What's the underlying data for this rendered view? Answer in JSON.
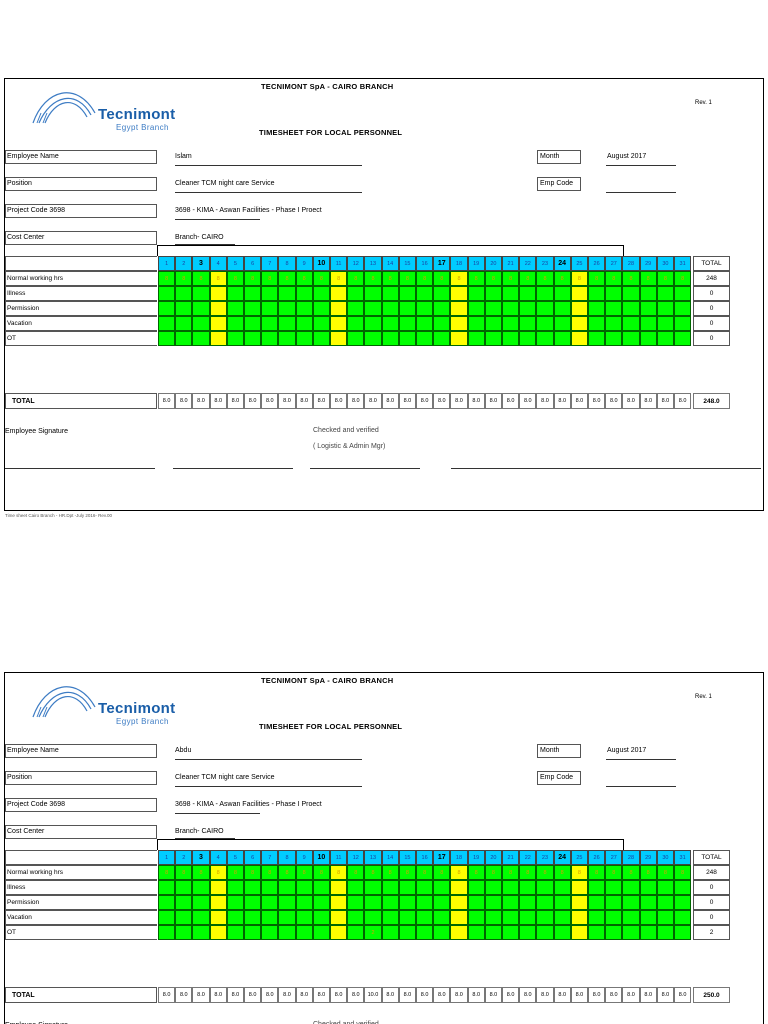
{
  "sheets": [
    {
      "company": "TECNIMONT SpA - CAIRO BRANCH",
      "logo": {
        "name": "Tecnimont",
        "sub": "Egypt Branch"
      },
      "rev": "Rev. 1",
      "title": "TIMESHEET FOR LOCAL PERSONNEL",
      "fields": {
        "employee_name_label": "Employee Name",
        "employee_name": "Islam",
        "position_label": "Position",
        "position": "Cleaner TCM night care Service",
        "project_code_label": "Project Code 3698",
        "project": "3698 - KIMA - Aswan Facilities - Phase I Proect",
        "cost_center_label": "Cost Center",
        "cost_center": "Branch- CAIRO",
        "month_label": "Month",
        "month": "August 2017",
        "emp_code_label": "Emp Code",
        "emp_code": ""
      },
      "total_header": "TOTAL",
      "rows": [
        {
          "label": "Normal working hrs",
          "cells": "8",
          "total": "248"
        },
        {
          "label": "Illness",
          "cells": "",
          "total": "0"
        },
        {
          "label": "Permission",
          "cells": "",
          "total": "0"
        },
        {
          "label": "Vacation",
          "cells": "",
          "total": "0"
        },
        {
          "label": "OT",
          "cells": "",
          "total": "0"
        }
      ],
      "ot_values": {},
      "total_label": "TOTAL",
      "daily_totals": [
        "8.0",
        "8.0",
        "8.0",
        "8.0",
        "8.0",
        "8.0",
        "8.0",
        "8.0",
        "8.0",
        "8.0",
        "8.0",
        "8.0",
        "8.0",
        "8.0",
        "8.0",
        "8.0",
        "8.0",
        "8.0",
        "8.0",
        "8.0",
        "8.0",
        "8.0",
        "8.0",
        "8.0",
        "8.0",
        "8.0",
        "8.0",
        "8.0",
        "8.0",
        "8.0",
        "8.0"
      ],
      "grand_total": "248.0",
      "signature_label": "Employee Signature",
      "checked": "Checked and verified",
      "checked_by": "( Logistic & Admin Mgr)",
      "footer_note": "Time sheet Cairo Branch - HR.Dpt -July 2016- Rev.00"
    },
    {
      "company": "TECNIMONT SpA - CAIRO BRANCH",
      "logo": {
        "name": "Tecnimont",
        "sub": "Egypt Branch"
      },
      "rev": "Rev. 1",
      "title": "TIMESHEET FOR LOCAL PERSONNEL",
      "fields": {
        "employee_name_label": "Employee Name",
        "employee_name": "Abdu",
        "position_label": "Position",
        "position": "Cleaner TCM night care Service",
        "project_code_label": "Project Code 3698",
        "project": "3698 - KIMA - Aswan Facilities - Phase I Proect",
        "cost_center_label": "Cost Center",
        "cost_center": "Branch- CAIRO",
        "month_label": "Month",
        "month": "August 2017",
        "emp_code_label": "Emp Code",
        "emp_code": ""
      },
      "total_header": "TOTAL",
      "rows": [
        {
          "label": "Normal working hrs",
          "cells": "8",
          "total": "248"
        },
        {
          "label": "Illness",
          "cells": "",
          "total": "0"
        },
        {
          "label": "Permission",
          "cells": "",
          "total": "0"
        },
        {
          "label": "Vacation",
          "cells": "",
          "total": "0"
        },
        {
          "label": "OT",
          "cells": "",
          "total": "2"
        }
      ],
      "ot_values": {
        "13": "2"
      },
      "total_label": "TOTAL",
      "daily_totals": [
        "8.0",
        "8.0",
        "8.0",
        "8.0",
        "8.0",
        "8.0",
        "8.0",
        "8.0",
        "8.0",
        "8.0",
        "8.0",
        "8.0",
        "10.0",
        "8.0",
        "8.0",
        "8.0",
        "8.0",
        "8.0",
        "8.0",
        "8.0",
        "8.0",
        "8.0",
        "8.0",
        "8.0",
        "8.0",
        "8.0",
        "8.0",
        "8.0",
        "8.0",
        "8.0",
        "8.0"
      ],
      "grand_total": "250.0",
      "signature_label": "Employee Signature",
      "checked": "Checked and verified",
      "checked_by": "",
      "footer_note": ""
    }
  ],
  "days": [
    "1",
    "2",
    "3",
    "4",
    "5",
    "6",
    "7",
    "8",
    "9",
    "10",
    "11",
    "12",
    "13",
    "14",
    "15",
    "16",
    "17",
    "18",
    "19",
    "20",
    "21",
    "22",
    "23",
    "24",
    "25",
    "26",
    "27",
    "28",
    "29",
    "30",
    "31"
  ],
  "bold_days": [
    3,
    10,
    17,
    24
  ],
  "weekend_days": [
    4,
    11,
    18,
    25
  ],
  "colors": {
    "work_green": "#00ff00",
    "weekend_yellow": "#ffff00",
    "day_header_cyan": "#00ccff",
    "brand_blue": "#1a5ea8"
  }
}
